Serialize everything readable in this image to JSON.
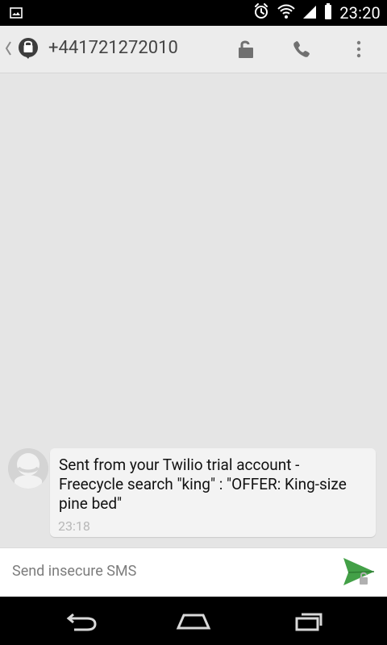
{
  "status_bar": {
    "time": "23:20",
    "icons": [
      "picture-icon",
      "alarm-icon",
      "wifi-icon",
      "signal-icon",
      "battery-icon"
    ]
  },
  "app_bar": {
    "title": "+441721272010",
    "icons": [
      "back-icon",
      "messaging-app-icon",
      "unlock-icon",
      "phone-icon",
      "overflow-menu-icon"
    ]
  },
  "message": {
    "text": "Sent from your Twilio trial account - Freecycle search \"king\" : \"OFFER: King-size pine bed\"",
    "time": "23:18"
  },
  "composer": {
    "placeholder": "Send insecure SMS"
  },
  "nav_bar": {
    "icons": [
      "back-nav-icon",
      "home-nav-icon",
      "recent-apps-icon"
    ]
  },
  "colors": {
    "status_bar": "#000000",
    "app_bar": "#ececec",
    "background": "#e5e5e5",
    "bubble": "#f3f3f3",
    "accent": "#43a047"
  }
}
